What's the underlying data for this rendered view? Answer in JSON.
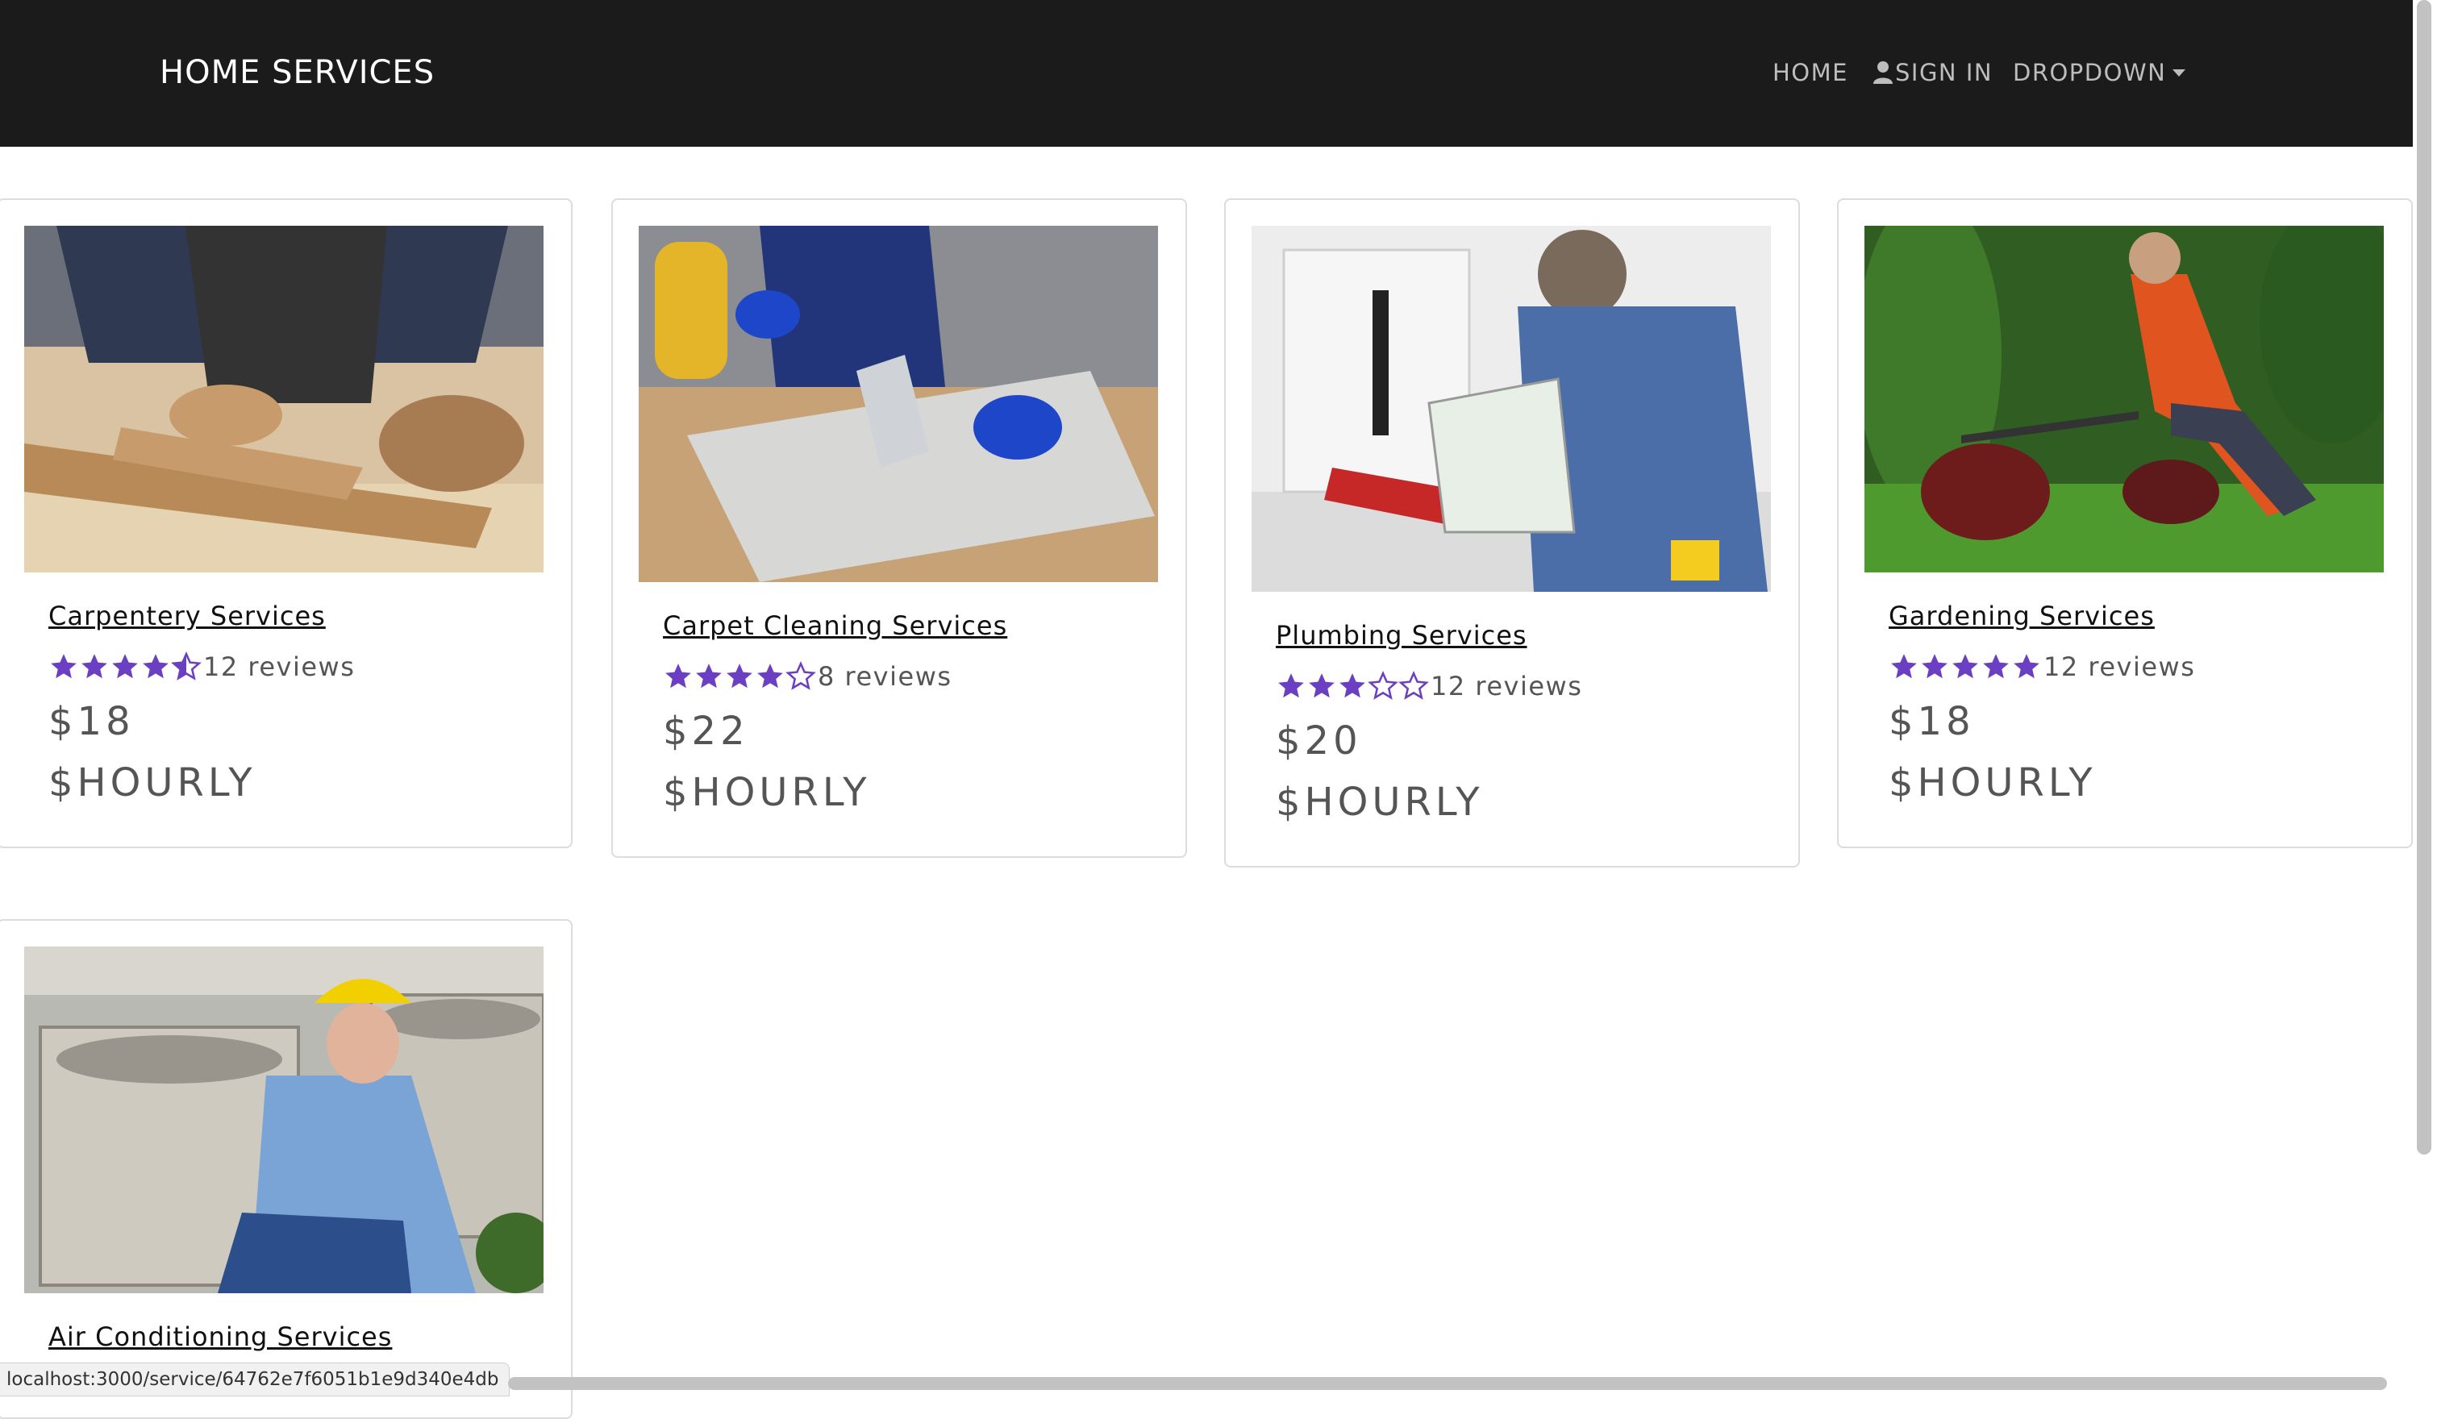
{
  "navbar": {
    "brand": "HOME SERVICES",
    "home_label": "HOME",
    "signin_label": "SIGN IN",
    "dropdown_label": "DROPDOWN"
  },
  "colors": {
    "navbar_bg": "#1b1b1b",
    "star": "#6a3fc1",
    "accent_text": "#555555"
  },
  "services": [
    {
      "title": "Carpentery Services",
      "rating": 4.5,
      "reviews": "12 reviews",
      "price": "$18",
      "unit": "$HOURLY",
      "image": "carpentry-photo"
    },
    {
      "title": "Carpet Cleaning Services",
      "rating": 4,
      "reviews": "8 reviews",
      "price": "$22",
      "unit": "$HOURLY",
      "image": "carpet-cleaning-photo"
    },
    {
      "title": "Plumbing Services",
      "rating": 3,
      "reviews": "12 reviews",
      "price": "$20",
      "unit": "$HOURLY",
      "image": "plumbing-photo"
    },
    {
      "title": "Gardening Services",
      "rating": 5,
      "reviews": "12 reviews",
      "price": "$18",
      "unit": "$HOURLY",
      "image": "gardening-photo"
    },
    {
      "title": "Air Conditioning Services",
      "image": "air-conditioning-photo"
    }
  ],
  "status_bar": {
    "url": "localhost:3000/service/64762e7f6051b1e9d340e4db"
  }
}
